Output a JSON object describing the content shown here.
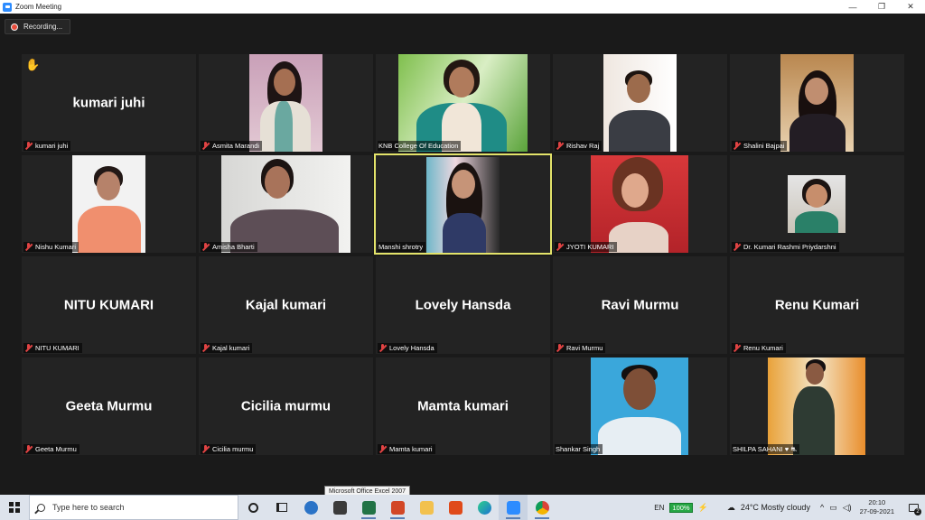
{
  "window": {
    "title": "Zoom Meeting",
    "controls": {
      "minimize": "—",
      "maximize": "❐",
      "close": "✕"
    }
  },
  "recording": {
    "label": "Recording..."
  },
  "participants": [
    {
      "name": "kumari juhi",
      "display": "kumari juhi",
      "hand_raised": true
    },
    {
      "name": "Asmita Marandi",
      "video": true
    },
    {
      "name": "KNB College Of Education",
      "video": true
    },
    {
      "name": "Rishav Raj",
      "video": true
    },
    {
      "name": "Shalini Bajpai",
      "video": true
    },
    {
      "name": "Nishu Kumari",
      "video": true
    },
    {
      "name": "Amisha Bharti",
      "video": true
    },
    {
      "name": "Manshi shrotry",
      "video": true,
      "active_speaker": true
    },
    {
      "name": "JYOTI KUMARI",
      "video": true
    },
    {
      "name": "Dr. Kumari Rashmi Priydarshni",
      "video": true
    },
    {
      "name": "NITU KUMARI",
      "display": "NITU KUMARI"
    },
    {
      "name": "Kajal kumari",
      "display": "Kajal kumari"
    },
    {
      "name": "Lovely Hansda",
      "display": "Lovely Hansda"
    },
    {
      "name": "Ravi Murmu",
      "display": "Ravi Murmu"
    },
    {
      "name": "Renu Kumari",
      "display": "Renu Kumari"
    },
    {
      "name": "Geeta Murmu",
      "display": "Geeta Murmu"
    },
    {
      "name": "Cicilia murmu",
      "display": "Cicilia murmu"
    },
    {
      "name": "Mamta kumari",
      "display": "Mamta kumari"
    },
    {
      "name": "Shankar Singh",
      "video": true
    },
    {
      "name": "SHILPA SAHANI ♥ ⛐",
      "video": true
    }
  ],
  "taskbar": {
    "search_placeholder": "Type here to search",
    "tooltip": "Microsoft Office Excel 2007",
    "language": "EN",
    "battery": "100%",
    "weather": "24°C  Mostly cloudy",
    "time": "20:10",
    "date": "27-09-2021",
    "notifications": "2"
  },
  "colors": {
    "active_speaker_border": "#e3e36a",
    "muted_mic": "#e04343",
    "battery": "#27a745",
    "zoom_blue": "#2d8cff"
  }
}
